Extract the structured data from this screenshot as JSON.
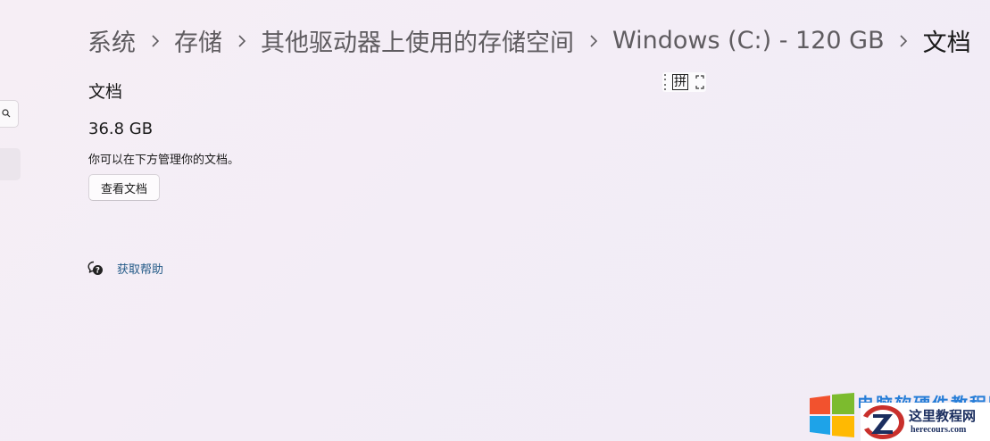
{
  "breadcrumb": {
    "items": [
      {
        "label": "系统"
      },
      {
        "label": "存储"
      },
      {
        "label": "其他驱动器上使用的存储空间"
      },
      {
        "label": "Windows (C:) - 120 GB"
      },
      {
        "label": "文档"
      }
    ]
  },
  "section": {
    "title": "文档",
    "size": "36.8 GB",
    "description": "你可以在下方管理你的文档。",
    "view_button_label": "查看文档"
  },
  "help": {
    "label": "获取帮助"
  },
  "ime_toolbar": {
    "mode_label": "拼"
  },
  "watermark": {
    "top_text": "电脑软硬件教程网",
    "site_name": "这里教程网",
    "site_url": "herecours.com"
  },
  "colors": {
    "link": "#245b88",
    "background": "#f5eef5",
    "watermark_blue": "#1c78d6"
  },
  "icons": {
    "search": "search-icon",
    "breadcrumb_separator": "chevron-right-icon",
    "help": "help-chat-icon",
    "ime_expand": "expand-icon",
    "windows_logo": "windows-logo-icon",
    "site_logo": "z-logo-icon"
  }
}
